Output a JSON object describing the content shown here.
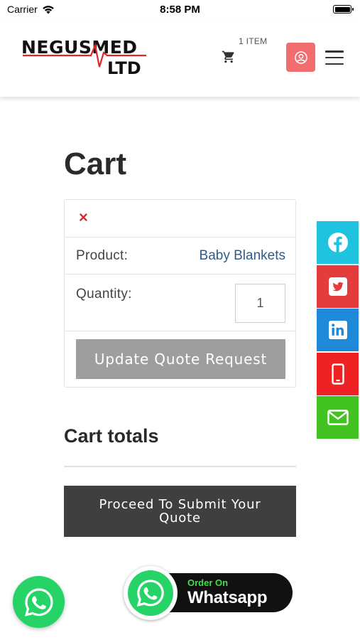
{
  "status_bar": {
    "carrier": "Carrier",
    "time": "8:58 PM"
  },
  "header": {
    "logo_line1": "NEGUSMED",
    "logo_line2": "LTD",
    "cart_count": "1 ITEM",
    "icons": {
      "cart": "shopping-cart-icon",
      "account": "user-circle-icon",
      "menu": "hamburger-menu-icon"
    },
    "colors": {
      "account_bg": "#f26d6d",
      "logo_red": "#e0262a"
    }
  },
  "cart": {
    "title": "Cart",
    "remove_symbol": "×",
    "product_label": "Product:",
    "product_name": "Baby Blankets",
    "quantity_label": "Quantity:",
    "quantity_value": "1",
    "update_button": "Update Quote Request"
  },
  "totals": {
    "title": "Cart totals",
    "proceed_button": "Proceed To Submit Your Quote"
  },
  "social_bar": [
    {
      "icon": "facebook-icon",
      "color": "#1fc3df"
    },
    {
      "icon": "twitter-icon",
      "color": "#e43c3c"
    },
    {
      "icon": "linkedin-icon",
      "color": "#1e88d9"
    },
    {
      "icon": "phone-icon",
      "color": "#ee2222"
    },
    {
      "icon": "email-icon",
      "color": "#43c322"
    }
  ],
  "whatsapp": {
    "order_on": "Order On",
    "brand": "Whatsapp",
    "color": "#25d366"
  }
}
